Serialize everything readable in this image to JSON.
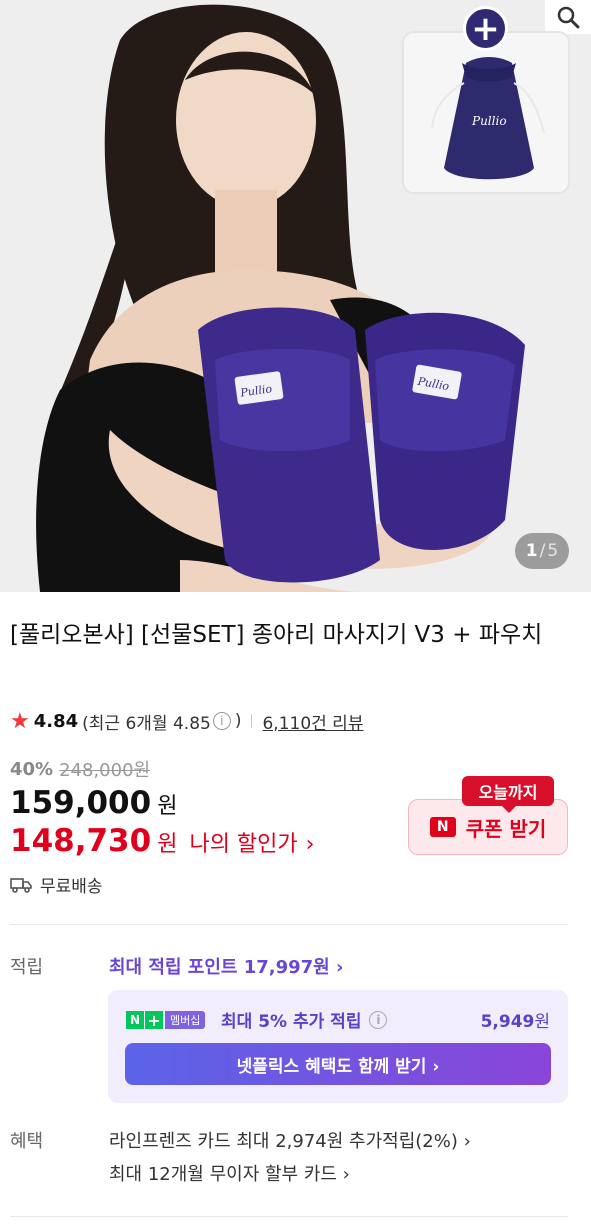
{
  "hero": {
    "brand_logo": "Pullio",
    "counter_current": "1",
    "counter_separator": "/",
    "counter_total": "5",
    "plus_symbol": "+"
  },
  "product": {
    "title": "[풀리오본사] [선물SET] 종아리 마사지기 V3 + 파우치"
  },
  "rating": {
    "score": "4.84",
    "recent_label": "(최근 6개월 4.85",
    "recent_close": ")",
    "review_count": "6,110건 리뷰"
  },
  "price": {
    "discount_percent": "40%",
    "original_price": "248,000원",
    "sale_price": "159,000",
    "won": "원",
    "my_price": "148,730",
    "my_discount_label": "나의 할인가",
    "chevron": "›"
  },
  "coupon": {
    "tag": "오늘까지",
    "badge": "N",
    "label": "쿠폰 받기"
  },
  "shipping": {
    "label": "무료배송"
  },
  "points": {
    "section_label": "적립",
    "max_points_link": "최대 적립 포인트 17,997원 ›",
    "member_badge_n": "N",
    "member_badge_plus": "+",
    "member_badge_label": "멤버십",
    "member_desc": "최대 5% 추가 적립",
    "member_amount_value": "5,949",
    "member_amount_unit": "원",
    "netflix_button": "넷플릭스 혜택도 함께 받기 ›"
  },
  "benefits": {
    "section_label": "혜택",
    "items": [
      "라인프렌즈 카드 최대 2,974원 추가적립(2%) ›",
      "최대 12개월 무이자 할부 카드 ›"
    ]
  },
  "colors": {
    "sale_red": "#e0001b",
    "points_purple": "#6a46d6",
    "member_bg": "#f1edfc",
    "star": "#f23a3a"
  }
}
